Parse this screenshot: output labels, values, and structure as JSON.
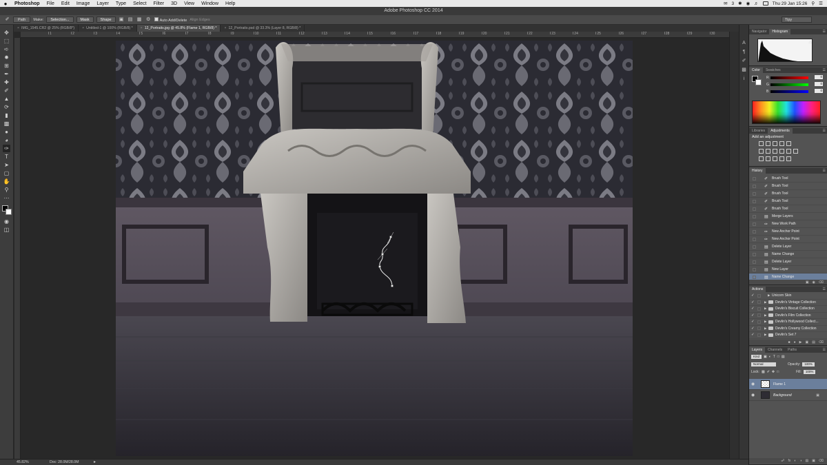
{
  "menubar": {
    "app": "Photoshop",
    "items": [
      "File",
      "Edit",
      "Image",
      "Layer",
      "Type",
      "Select",
      "Filter",
      "3D",
      "View",
      "Window",
      "Help"
    ],
    "badge": "3",
    "clock": "Thu 29 Jan  15:26"
  },
  "window": {
    "title": "Adobe Photoshop CC 2014"
  },
  "options": {
    "mode": "Path",
    "make_label": "Make:",
    "selection_btn": "Selection...",
    "mask_btn": "Mask",
    "shape_btn": "Shape",
    "auto_add": "Auto Add/Delete",
    "align_edges": "Align Edges",
    "workspace": "Tipy"
  },
  "tabs": [
    {
      "label": "IMG_1545.CR2 @ 25% (RGB/8*)",
      "active": false
    },
    {
      "label": "Untitled-1 @ 100% (RGB/8) *",
      "active": false
    },
    {
      "label": "12_Portraits.jpg @ 45.8% (Flame 1, RGB/8) *",
      "active": true
    },
    {
      "label": "12_Portraits.psd @ 33.3% (Layer 8, RGB/8) *",
      "active": false
    }
  ],
  "ruler": {
    "numbers": [
      "1",
      "2",
      "3",
      "4",
      "5",
      "6",
      "7",
      "8",
      "9",
      "10",
      "11",
      "12",
      "13",
      "14",
      "15",
      "16",
      "17",
      "18",
      "19",
      "20",
      "21",
      "22",
      "23",
      "24",
      "25",
      "26",
      "27",
      "28",
      "29",
      "30"
    ]
  },
  "statusbar": {
    "zoom": "45.82%",
    "doc": "Doc: 28.0M/28.0M"
  },
  "panels": {
    "navigator_tabs": [
      "Navigator",
      "Histogram"
    ],
    "color_tabs": [
      "Color",
      "Swatches"
    ],
    "color_values": {
      "R": "0",
      "G": "0",
      "B": "0"
    },
    "adjust_tabs": [
      "Libraries",
      "Adjustments"
    ],
    "adjust_title": "Add an adjustment",
    "history_title": "History",
    "history": [
      {
        "label": "Brush Tool",
        "icon": "brush-icon"
      },
      {
        "label": "Brush Tool",
        "icon": "brush-icon"
      },
      {
        "label": "Brush Tool",
        "icon": "brush-icon"
      },
      {
        "label": "Brush Tool",
        "icon": "brush-icon"
      },
      {
        "label": "Brush Tool",
        "icon": "brush-icon"
      },
      {
        "label": "Merge Layers",
        "icon": "layers-icon"
      },
      {
        "label": "New Work Path",
        "icon": "pen-icon"
      },
      {
        "label": "New Anchor Point",
        "icon": "pen-icon"
      },
      {
        "label": "New Anchor Point",
        "icon": "pen-icon"
      },
      {
        "label": "Delete Layer",
        "icon": "layers-icon"
      },
      {
        "label": "Name Change",
        "icon": "layers-icon"
      },
      {
        "label": "Delete Layer",
        "icon": "layers-icon"
      },
      {
        "label": "New Layer",
        "icon": "layers-icon"
      },
      {
        "label": "Name Change",
        "icon": "layers-icon",
        "selected": true
      }
    ],
    "actions_title": "Actions",
    "actions": [
      {
        "label": "Unicorn Skin",
        "folder": false
      },
      {
        "label": "Devlin's Vintage Collection",
        "folder": true
      },
      {
        "label": "Devlin's Biscuit Collection",
        "folder": true
      },
      {
        "label": "Devlin's Film Collection",
        "folder": true
      },
      {
        "label": "Devlin's Hollywood Collect...",
        "folder": true
      },
      {
        "label": "Devlin's Creamy Collection",
        "folder": true
      },
      {
        "label": "Devlin's Set 7",
        "folder": true
      }
    ],
    "layers_tabs": [
      "Layers",
      "Channels",
      "Paths"
    ],
    "layers_kind": "Kind",
    "blend_mode": "Normal",
    "opacity_label": "Opacity:",
    "opacity": "100%",
    "lock_label": "Lock:",
    "fill_label": "Fill:",
    "fill": "100%",
    "layers": [
      {
        "name": "Flame 1",
        "selected": true
      },
      {
        "name": "Background",
        "selected": false,
        "locked": true
      }
    ]
  },
  "colors": {
    "accent": "#6b7f9c",
    "panel": "#535353",
    "chrome": "#3a3a3a"
  }
}
